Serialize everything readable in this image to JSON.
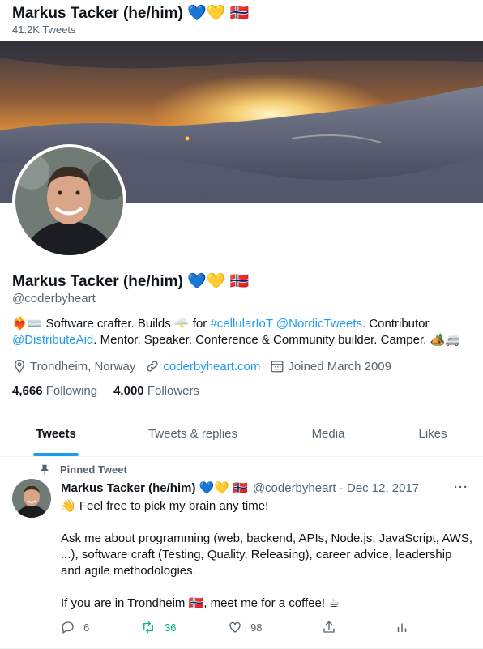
{
  "header": {
    "name": "Markus Tacker (he/him) 💙💛 🇳🇴",
    "tweet_count": "41.2K Tweets"
  },
  "profile": {
    "name": "Markus Tacker (he/him) 💙💛 🇳🇴",
    "handle": "@coderbyheart",
    "bio": {
      "part1": "❤️‍🔥⌨️ Software crafter. Builds 🌩️ for ",
      "tag": "#cellularIoT",
      "mention1": "@NordicTweets",
      "part2": ". Contributor ",
      "mention2": "@DistributeAid",
      "part3": ". Mentor. Speaker. Conference & Community builder. Camper. 🏕️🚐"
    },
    "location": "Trondheim, Norway",
    "website": "coderbyheart.com",
    "joined": "Joined March 2009",
    "following_count": "4,666",
    "following_label": "Following",
    "followers_count": "4,000",
    "followers_label": "Followers"
  },
  "tabs": [
    "Tweets",
    "Tweets & replies",
    "Media",
    "Likes"
  ],
  "tweet": {
    "pinned_label": "Pinned Tweet",
    "author": "Markus Tacker (he/him) 💙💛 🇳🇴",
    "handle_date": "@coderbyheart · Dec 12, 2017",
    "more": "···",
    "line1": "👋 Feel free to pick my brain any time!",
    "line2": "Ask me about programming (web, backend, APIs, Node.js, JavaScript, AWS, ...), software craft (Testing, Quality, Releasing), career advice, leadership and agile methodologies.",
    "line3": "If you are in Trondheim 🇳🇴, meet me for a coffee! ☕",
    "replies": "6",
    "retweets": "36",
    "likes": "98"
  }
}
